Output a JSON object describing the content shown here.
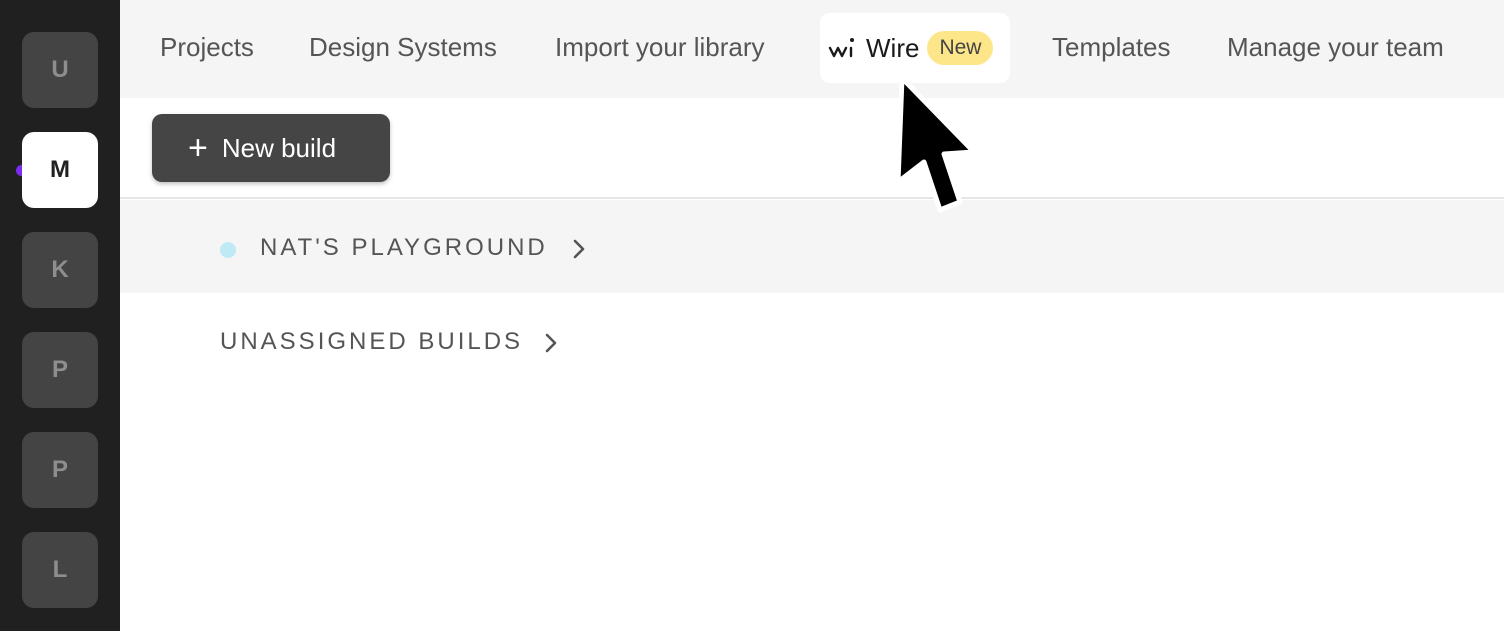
{
  "sidebar": {
    "workspaces": [
      {
        "initial": "U",
        "active": false
      },
      {
        "initial": "M",
        "active": true
      },
      {
        "initial": "K",
        "active": false
      },
      {
        "initial": "P",
        "active": false
      },
      {
        "initial": "P",
        "active": false
      },
      {
        "initial": "L",
        "active": false
      }
    ],
    "active_indicator_color": "#7c2cf0"
  },
  "topnav": {
    "projects": "Projects",
    "design_systems": "Design Systems",
    "import_library": "Import your library",
    "wire": {
      "label": "Wire",
      "badge": "New",
      "icon": "wire-logo-icon"
    },
    "templates": "Templates",
    "manage_team": "Manage your team"
  },
  "toolbar": {
    "new_build_label": "New build",
    "new_build_icon": "plus-icon"
  },
  "groups": [
    {
      "label": "NAT'S PLAYGROUND",
      "dot_color": "#bfeaf5",
      "icon": "chevron-right-icon"
    }
  ],
  "unassigned": {
    "label": "UNASSIGNED BUILDS",
    "icon": "chevron-right-icon"
  },
  "colors": {
    "sidebar_bg": "#202020",
    "nav_bg": "#f5f5f5",
    "badge_bg": "#fde68a",
    "button_bg": "#454545"
  }
}
